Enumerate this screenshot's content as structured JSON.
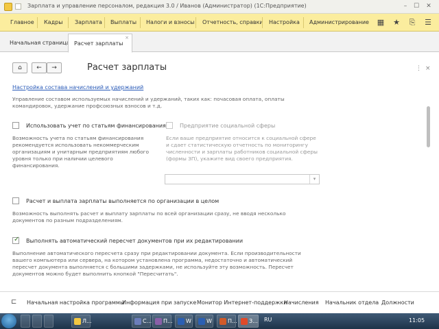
{
  "window": {
    "title": "Зарплата и управление персоналом, редакция 3.0 / Иванов (Администратор) (1С:Предприятие)",
    "controls": [
      "–",
      "☐",
      "✕"
    ]
  },
  "menu": {
    "items": [
      "Главное",
      "Кадры",
      "Зарплата",
      "Выплаты",
      "Налоги и взносы",
      "Отчетность, справки",
      "Настройка",
      "Администрирование"
    ],
    "icons": [
      "grid-icon",
      "star-icon",
      "history-icon",
      "menu-icon"
    ]
  },
  "tabs": [
    {
      "label": "Начальная страница",
      "active": false
    },
    {
      "label": "Расчет зарплаты",
      "active": true,
      "close": "×"
    }
  ],
  "form": {
    "title": "Расчет зарплаты",
    "home_label": "⌂",
    "back_label": "←",
    "forward_label": "→",
    "more_label": "⋮",
    "close_label": "×",
    "link": "Настройка состава начислений и удержаний",
    "link_desc": "Управление составом используемых начислений и удержаний, таких как: почасовая оплата, оплаты командировок, удержание профсоюзных взносов и т.д.",
    "opt1_label": "Использовать учет по статьям финансирования",
    "opt1_checked": false,
    "opt1_desc": "Возможность учета по статьям финансирования рекомендуется использовать некоммерческим организациям и унитарным предприятиям любого уровня только при наличии целевого финансирования.",
    "opt2_label": "Предприятие социальной сферы",
    "opt2_checked": false,
    "opt2_desc": "Если ваше предприятие относится к социальной сфере и сдает статистическую отчетность по мониторингу численности и зарплаты работников социальной сферы (формы ЗП), укажите вид своего предприятия.",
    "select_value": "",
    "select_arrow": "▾",
    "opt3_label": "Расчет и выплата зарплаты выполняется по организации в целом",
    "opt3_checked": false,
    "opt3_desc": "Возможность выполнять расчет и выплату зарплаты по всей организации сразу, не вводя несколько документов по разным подразделениям.",
    "opt4_label": "Выполнять автоматический пересчет документов при их редактировании",
    "opt4_checked": true,
    "opt4_tick": "✓",
    "opt4_desc": "Выполнение автоматического пересчета сразу при редактировании документа. Если производительности вашего компьютера или сервера, на котором установлена программа, недостаточно и автоматический пересчет документа выполняется с большими задержками, не используйте эту возможность. Пересчет документов можно будет выполнить кнопкой \"Пересчитать\"."
  },
  "bottom": {
    "items": [
      "Начальная настройка программы",
      "Информация при запуске",
      "Монитор Интернет-поддержки",
      "Начисления",
      "Начальник отдела",
      "Должности"
    ]
  },
  "taskbar": {
    "buttons": [
      "Л...",
      "С...",
      "П...",
      "W",
      "W",
      "П...",
      "З..."
    ],
    "lang": "RU",
    "time": "11:05"
  }
}
